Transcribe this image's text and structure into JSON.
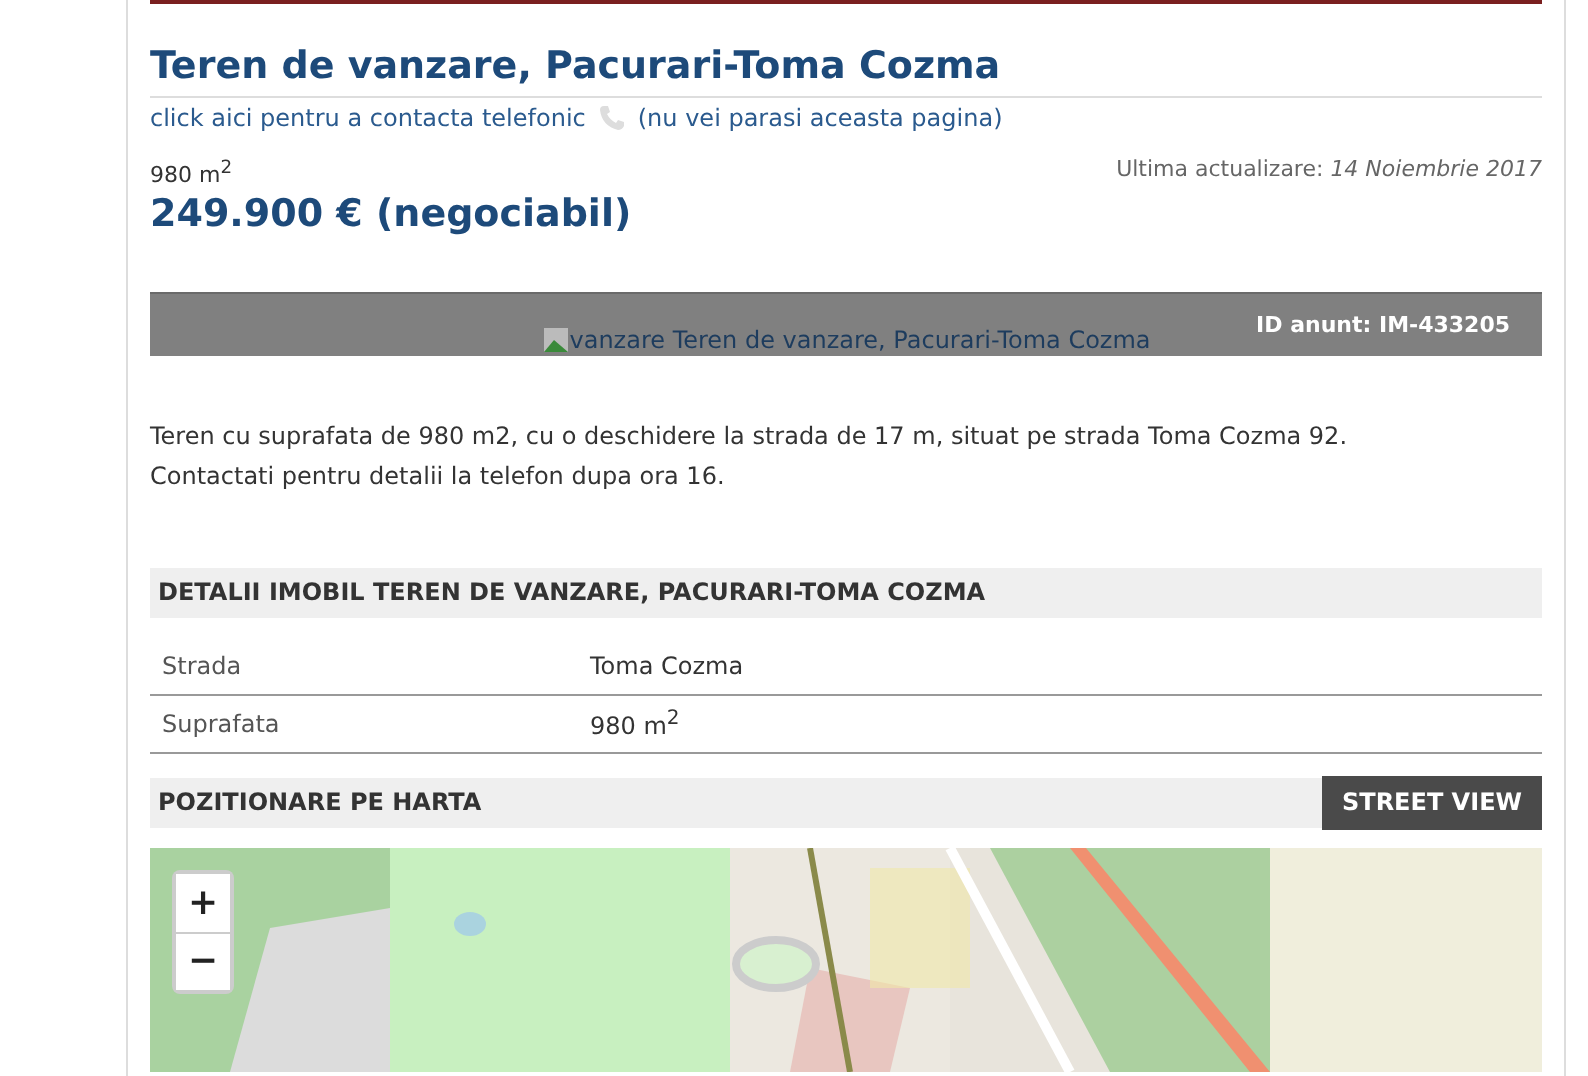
{
  "listing": {
    "title": "Teren de vanzare, Pacurari-Toma Cozma",
    "contact_link": "click aici pentru a contacta telefonic",
    "contact_note": "(nu vei parasi aceasta pagina)",
    "area": "980 m$^{2}$",
    "price": "249.900 € (negociabil)",
    "updated_label": "Ultima actualizare:",
    "updated_date": "14 Noiembrie 2017"
  },
  "image": {
    "alt": "vanzare Teren de vanzare, Pacurari-Toma Cozma",
    "id_label": "ID anunt: IM-433205"
  },
  "description": [
    "Teren cu suprafata de 980 m2, cu o deschidere la strada de 17 m, situat pe strada Toma Cozma 92.",
    "Contactati pentru detalii la telefon dupa ora 16."
  ],
  "details": {
    "heading": "DETALII IMOBIL TEREN DE VANZARE, PACURARI-TOMA COZMA",
    "rows": [
      {
        "label": "Strada",
        "value": "Toma Cozma"
      },
      {
        "label": "Suprafata",
        "value": "980 m$^{2}$"
      }
    ]
  },
  "map": {
    "heading": "POZITIONARE PE HARTA",
    "street_view": "STREET VIEW",
    "zoom_in": "+",
    "zoom_out": "−"
  }
}
